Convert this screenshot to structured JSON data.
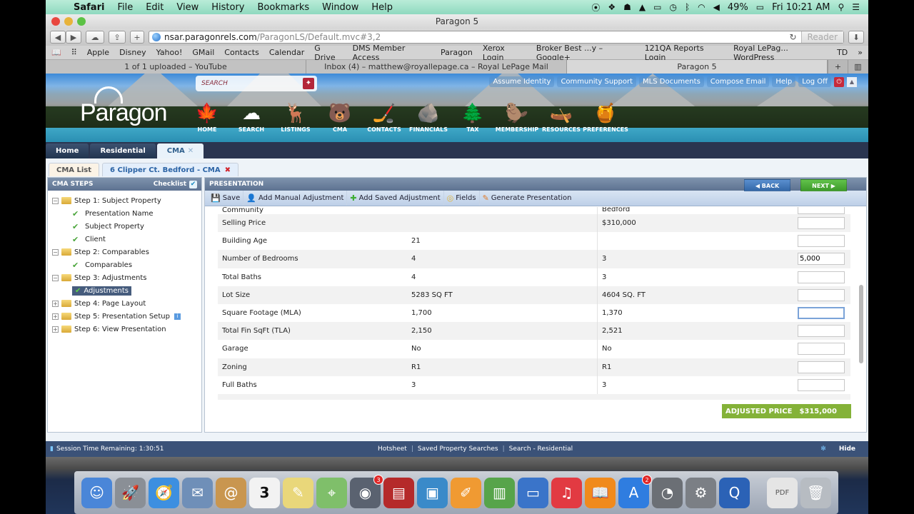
{
  "menubar": {
    "app": "Safari",
    "items": [
      "File",
      "Edit",
      "View",
      "History",
      "Bookmarks",
      "Window",
      "Help"
    ],
    "battery": "49%",
    "clock": "Fri 10:21 AM",
    "status_icons": [
      "record-icon",
      "dropbox-icon",
      "evernote-icon",
      "drive-icon",
      "airplay-icon",
      "time-machine-icon",
      "bluetooth-icon",
      "wifi-icon",
      "volume-icon",
      "battery-icon",
      "spotlight-icon",
      "notification-center-icon"
    ]
  },
  "window": {
    "title": "Paragon 5"
  },
  "toolbar": {
    "url_host": "nsar.paragonrels.com",
    "url_path": "/ParagonLS/Default.mvc#3,2",
    "reader_label": "Reader",
    "new_tab_label": "+"
  },
  "bookmarks": [
    "Apple",
    "Disney",
    "Yahoo!",
    "GMail",
    "Contacts",
    "Calendar",
    "G Drive",
    "DMS Member Access",
    "Paragon",
    "Xerox Login",
    "Broker Best ...y – Google+",
    "121QA Reports Login",
    "Royal LePag... WordPress",
    "TD"
  ],
  "browser_tabs": [
    {
      "label": "1 of 1 uploaded – YouTube",
      "active": false
    },
    {
      "label": "Inbox (4) – matthew@royallepage.ca – Royal LePage Mail",
      "active": false
    },
    {
      "label": "Paragon 5",
      "active": true
    }
  ],
  "paragon": {
    "logo": "Paragon",
    "search_placeholder": "SEARCH",
    "nav": [
      {
        "label": "HOME",
        "icon": "maple-leaf-icon",
        "glyph": "🍁"
      },
      {
        "label": "SEARCH",
        "icon": "cloud-icon",
        "glyph": "☁"
      },
      {
        "label": "LISTINGS",
        "icon": "moose-icon",
        "glyph": "🦌"
      },
      {
        "label": "CMA",
        "icon": "bear-icon",
        "glyph": "🐻"
      },
      {
        "label": "CONTACTS",
        "icon": "hockey-player-icon",
        "glyph": "🏒"
      },
      {
        "label": "FINANCIALS",
        "icon": "rocks-icon",
        "glyph": "🪨"
      },
      {
        "label": "TAX",
        "icon": "trees-icon",
        "glyph": "🌲"
      },
      {
        "label": "MEMBERSHIP",
        "icon": "beaver-icon",
        "glyph": "🦫"
      },
      {
        "label": "RESOURCES",
        "icon": "canoe-icon",
        "glyph": "🛶"
      },
      {
        "label": "PREFERENCES",
        "icon": "maple-syrup-icon",
        "glyph": "🍯"
      }
    ],
    "top_links": [
      "Assume Identity",
      "Community Support",
      "MLS Documents",
      "Compose Email",
      "Help",
      "Log Off"
    ],
    "main_tabs": [
      {
        "label": "Home",
        "active": false
      },
      {
        "label": "Residential",
        "active": false
      },
      {
        "label": "CMA",
        "active": true,
        "closable": true
      }
    ],
    "sub_tabs": [
      {
        "label": "CMA List"
      },
      {
        "label": "6 Clipper Ct. Bedford - CMA"
      }
    ]
  },
  "steps_panel": {
    "title": "CMA STEPS",
    "checklist_label": "Checklist",
    "tree": [
      {
        "label": "Step 1: Subject Property",
        "type": "folder",
        "expanded": true
      },
      {
        "label": "Presentation Name",
        "type": "done"
      },
      {
        "label": "Subject Property",
        "type": "done"
      },
      {
        "label": "Client",
        "type": "done"
      },
      {
        "label": "Step 2: Comparables",
        "type": "folder",
        "expanded": true
      },
      {
        "label": "Comparables",
        "type": "done"
      },
      {
        "label": "Step 3: Adjustments",
        "type": "folder",
        "expanded": true
      },
      {
        "label": "Adjustments",
        "type": "done",
        "selected": true
      },
      {
        "label": "Step 4: Page Layout",
        "type": "folder",
        "expanded": false
      },
      {
        "label": "Step 5: Presentation Setup",
        "type": "folder",
        "expanded": false,
        "info": true
      },
      {
        "label": "Step 6: View Presentation",
        "type": "folder",
        "expanded": false
      }
    ]
  },
  "presentation": {
    "title": "PRESENTATION",
    "toolbar": [
      {
        "label": "Save",
        "icon": "save-icon",
        "glyph": "💾"
      },
      {
        "label": "Add Manual Adjustment",
        "icon": "person-add-icon",
        "glyph": "👤"
      },
      {
        "label": "Add Saved Adjustment",
        "icon": "plus-icon",
        "glyph": "➕"
      },
      {
        "label": "Fields",
        "icon": "fields-icon",
        "glyph": "◎"
      },
      {
        "label": "Generate Presentation",
        "icon": "wand-icon",
        "glyph": "✎"
      }
    ],
    "back_label": "BACK",
    "next_label": "NEXT",
    "partial_row": {
      "field": "Community",
      "subject": "",
      "comparable": "Bedford",
      "adjustment": ""
    },
    "rows": [
      {
        "field": "Selling Price",
        "subject": "",
        "comparable": "$310,000",
        "adjustment": ""
      },
      {
        "field": "Building Age",
        "subject": "21",
        "comparable": "",
        "adjustment": ""
      },
      {
        "field": "Number of Bedrooms",
        "subject": "4",
        "comparable": "3",
        "adjustment": "5,000"
      },
      {
        "field": "Total Baths",
        "subject": "4",
        "comparable": "3",
        "adjustment": ""
      },
      {
        "field": "Lot Size",
        "subject": "5283 SQ FT",
        "comparable": "4604 SQ. FT",
        "adjustment": ""
      },
      {
        "field": "Square Footage (MLA)",
        "subject": "1,700",
        "comparable": "1,370",
        "adjustment": "",
        "focused": true
      },
      {
        "field": "Total Fin SqFt (TLA)",
        "subject": "2,150",
        "comparable": "2,521",
        "adjustment": ""
      },
      {
        "field": "Garage",
        "subject": "No",
        "comparable": "No",
        "adjustment": ""
      },
      {
        "field": "Zoning",
        "subject": "R1",
        "comparable": "R1",
        "adjustment": ""
      },
      {
        "field": "Full Baths",
        "subject": "3",
        "comparable": "3",
        "adjustment": ""
      }
    ],
    "adjusted_price_label": "ADJUSTED PRICE",
    "adjusted_price_value": "$315,000"
  },
  "statusbar": {
    "session": "Session Time Remaining: 1:30:51",
    "links": [
      "Hotsheet",
      "Saved Property Searches",
      "Search - Residential"
    ],
    "hide_label": "Hide"
  },
  "dock": [
    {
      "name": "finder-icon",
      "glyph": "☺",
      "color": "#4a86d8"
    },
    {
      "name": "launchpad-icon",
      "glyph": "🚀",
      "color": "#8a8f96"
    },
    {
      "name": "safari-icon",
      "glyph": "🧭",
      "color": "#3d8fe0"
    },
    {
      "name": "mail-icon",
      "glyph": "✉",
      "color": "#6f8fb8"
    },
    {
      "name": "contacts-icon",
      "glyph": "@",
      "color": "#c9964f"
    },
    {
      "name": "calendar-icon",
      "glyph": "3",
      "color": "#f2f2f2"
    },
    {
      "name": "notes-icon",
      "glyph": "✎",
      "color": "#e9d77a"
    },
    {
      "name": "maps-icon",
      "glyph": "⌖",
      "color": "#7fbf6a"
    },
    {
      "name": "facetime-icon",
      "glyph": "◉",
      "color": "#5a6270",
      "badge": "3"
    },
    {
      "name": "photo-booth-icon",
      "glyph": "▤",
      "color": "#b52a2a"
    },
    {
      "name": "iphoto-icon",
      "glyph": "▣",
      "color": "#3a8ac9"
    },
    {
      "name": "pages-icon",
      "glyph": "✐",
      "color": "#f09a32"
    },
    {
      "name": "numbers-icon",
      "glyph": "▥",
      "color": "#57a44a"
    },
    {
      "name": "keynote-icon",
      "glyph": "▭",
      "color": "#3a74c9"
    },
    {
      "name": "itunes-icon",
      "glyph": "♫",
      "color": "#e23a42"
    },
    {
      "name": "ibooks-icon",
      "glyph": "📖",
      "color": "#f08a1c"
    },
    {
      "name": "app-store-icon",
      "glyph": "A",
      "color": "#2f7de0",
      "badge": "2"
    },
    {
      "name": "time-machine-icon",
      "glyph": "◔",
      "color": "#6b6f75"
    },
    {
      "name": "system-preferences-icon",
      "glyph": "⚙",
      "color": "#7b7f85"
    },
    {
      "name": "quicktime-icon",
      "glyph": "Q",
      "color": "#2b62b6"
    },
    {
      "name": "pdf-document-icon",
      "glyph": "PDF",
      "color": "#e5e5e5"
    },
    {
      "name": "trash-icon",
      "glyph": "🗑",
      "color": "#b7bcc2"
    }
  ]
}
